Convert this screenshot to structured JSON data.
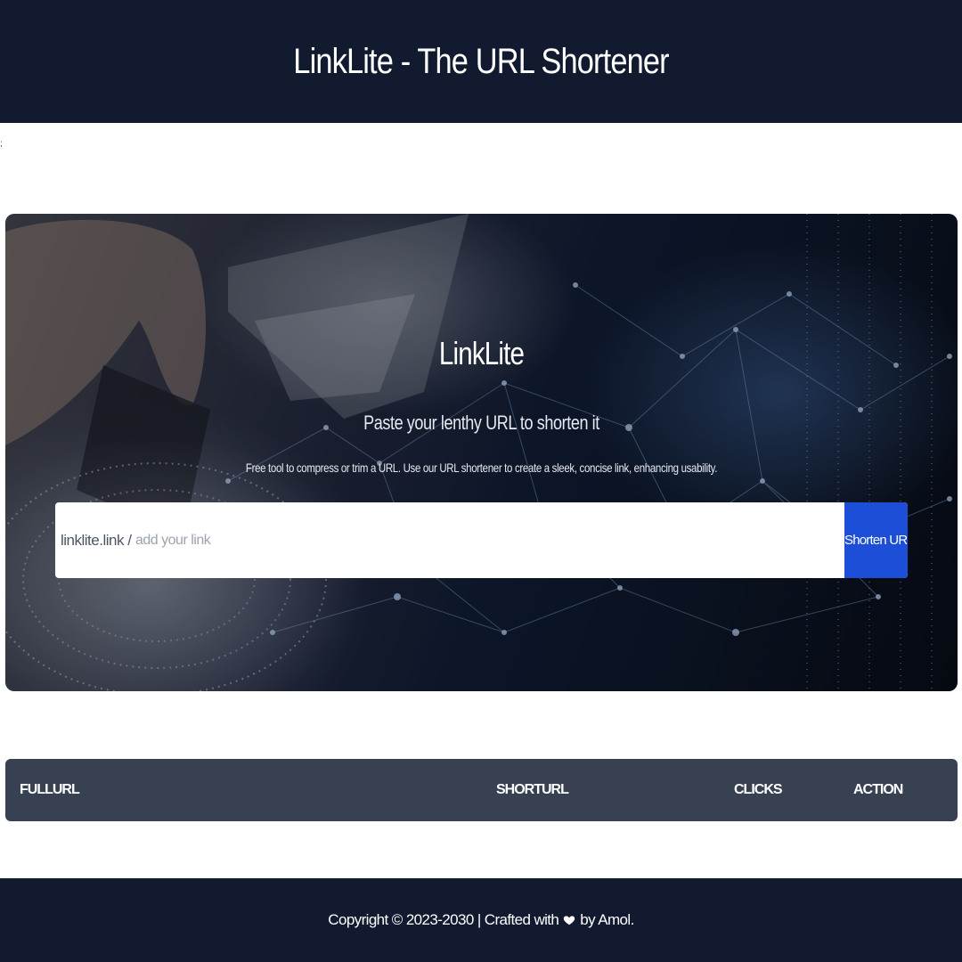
{
  "header": {
    "title": "LinkLite - The URL Shortener"
  },
  "stray_text": ";",
  "hero": {
    "title": "LinkLite",
    "subtitle": "Paste your lenthy URL to shorten it",
    "description": "Free tool to compress or trim a URL. Use our URL shortener to create a sleek, concise link, enhancing usability."
  },
  "form": {
    "prefix": "linklite.link /",
    "input_value": "",
    "input_placeholder": "add your link",
    "button_label": "Shorten URL"
  },
  "table": {
    "columns": [
      "FULLURL",
      "SHORTURL",
      "CLICKS",
      "ACTION"
    ],
    "rows": []
  },
  "footer": {
    "text_before": "Copyright © 2023-2030 | Crafted with",
    "icon": "heart-icon",
    "text_after": "by Amol."
  },
  "colors": {
    "header_bg": "#111a2e",
    "button_bg": "#1d4ed8",
    "table_header_bg": "#374151"
  }
}
